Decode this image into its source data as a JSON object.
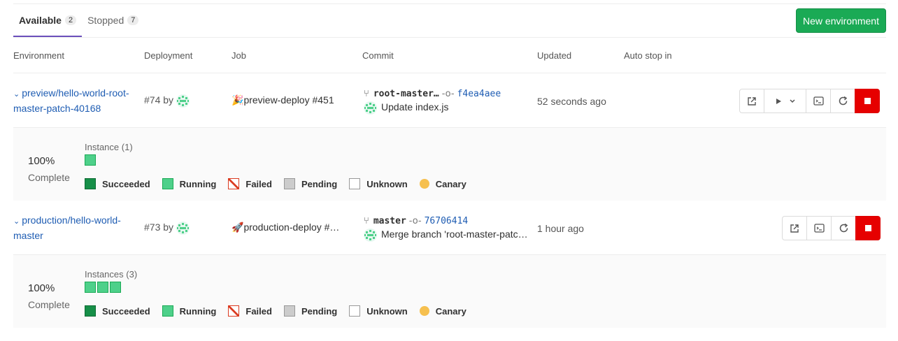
{
  "tabs": [
    {
      "label": "Available",
      "count": "2"
    },
    {
      "label": "Stopped",
      "count": "7"
    }
  ],
  "new_environment_label": "New environment",
  "columns": [
    "Environment",
    "Deployment",
    "Job",
    "Commit",
    "Updated",
    "Auto stop in"
  ],
  "environments": [
    {
      "name_line1": "preview/hello-world-root-",
      "name_line2": "master-patch-40168",
      "deployment": "#74 by",
      "job": "preview-deploy #451",
      "job_icon": "party-popper-icon",
      "ref": "root-master…",
      "sha": "f4ea4aee",
      "commit_message": "Update index.js",
      "updated": "52 seconds ago",
      "percent": "100%",
      "status": "Complete",
      "instances_label": "Instance (1)",
      "instances": 1
    },
    {
      "name_line1": "production/hello-world-",
      "name_line2": "master",
      "deployment": "#73 by",
      "job": "production-deploy #…",
      "job_icon": "rocket-icon",
      "ref": "master",
      "sha": "76706414",
      "commit_message": "Merge branch 'root-master-patc…",
      "updated": "1 hour ago",
      "percent": "100%",
      "status": "Complete",
      "instances_label": "Instances (3)",
      "instances": 3
    }
  ],
  "legend": [
    "Succeeded",
    "Running",
    "Failed",
    "Pending",
    "Unknown",
    "Canary"
  ],
  "colors": {
    "accent": "#6b4fbb",
    "primary": "#1aaa55",
    "danger": "#e60000",
    "link": "#1f5db3",
    "running": "#4ed08a",
    "canary": "#f6c04f"
  }
}
